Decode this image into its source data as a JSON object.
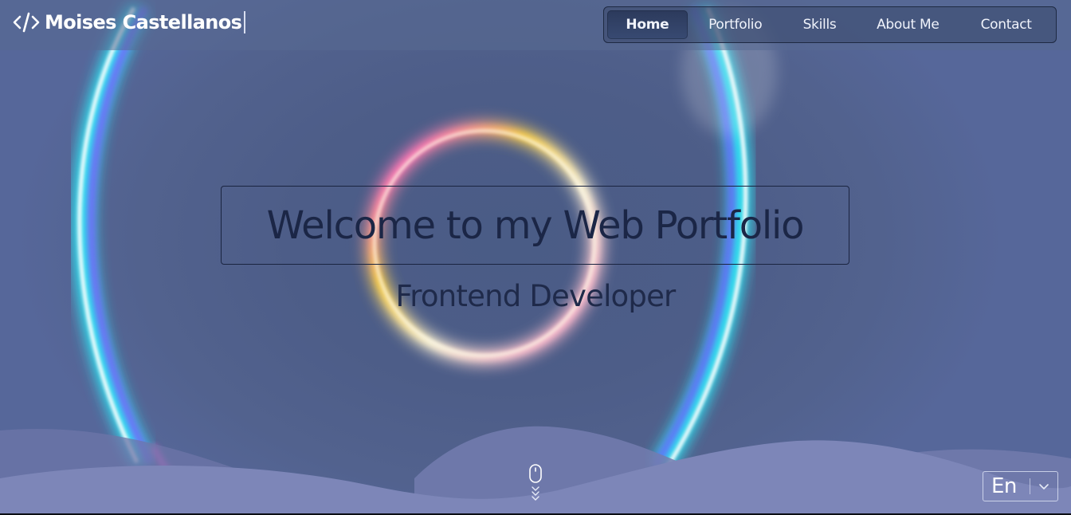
{
  "brand": {
    "name": "Moises Castellanos",
    "icon": "code-icon"
  },
  "nav": {
    "items": [
      {
        "label": "Home",
        "active": true
      },
      {
        "label": "Portfolio",
        "active": false
      },
      {
        "label": "Skills",
        "active": false
      },
      {
        "label": "About Me",
        "active": false
      },
      {
        "label": "Contact",
        "active": false
      }
    ]
  },
  "hero": {
    "title": "Welcome to my Web Portfolio",
    "subtitle": "Frontend Developer"
  },
  "scroll_indicator": {
    "icon": "mouse-scroll-icon"
  },
  "language": {
    "selected": "En",
    "icon": "chevron-down-icon"
  },
  "colors": {
    "background": "#4d5d88",
    "title_text": "#1b2646",
    "nav_active": "#2c3a5c",
    "wave": "#7d86b8"
  }
}
